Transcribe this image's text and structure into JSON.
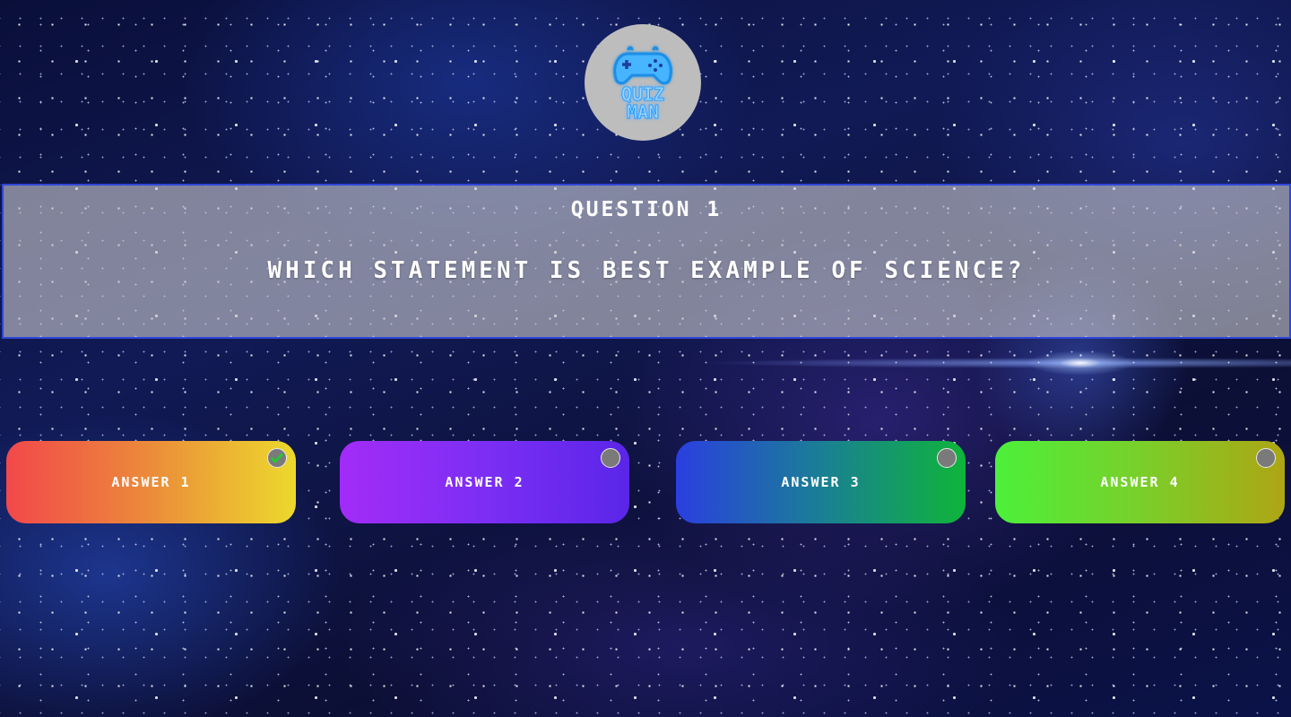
{
  "logo": {
    "icon": "gamepad-icon",
    "line1": "QUIZ",
    "line2": "MAN"
  },
  "question": {
    "number_label": "QUESTION 1",
    "text": "WHICH STATEMENT IS BEST EXAMPLE OF SCIENCE?"
  },
  "answers": [
    {
      "label": "ANSWER 1",
      "selected": true,
      "color_start": "#f2484a",
      "color_end": "#ecd92c"
    },
    {
      "label": "ANSWER 2",
      "selected": false,
      "color_start": "#a32cf7",
      "color_end": "#5a26e8"
    },
    {
      "label": "ANSWER 3",
      "selected": false,
      "color_start": "#2a3fe0",
      "color_end": "#0fb43a"
    },
    {
      "label": "ANSWER 4",
      "selected": false,
      "color_start": "#4cf03a",
      "color_end": "#aea514"
    }
  ],
  "colors": {
    "panel_border": "#2f46d8",
    "logo_neon": "#2aa0ff"
  }
}
